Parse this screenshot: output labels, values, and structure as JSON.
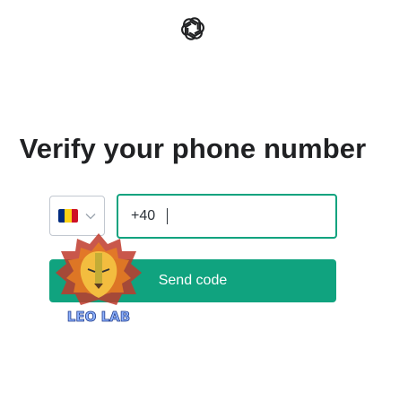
{
  "header": {
    "logo_icon": "openai-logo-icon"
  },
  "main": {
    "title": "Verify your phone number",
    "country_select": {
      "selected_country_flag": "romania-flag-icon",
      "flag_colors": [
        "#002B7F",
        "#FCD116",
        "#CE1126"
      ],
      "chevron_icon": "chevron-down-icon"
    },
    "phone_input": {
      "value": "+40"
    },
    "send_button_label": "Send code"
  },
  "watermark": {
    "text": "LEO LAB",
    "icon": "lion-head-icon"
  },
  "colors": {
    "accent": "#10a37f",
    "title_text": "#202123",
    "border": "#c2c8d0"
  }
}
